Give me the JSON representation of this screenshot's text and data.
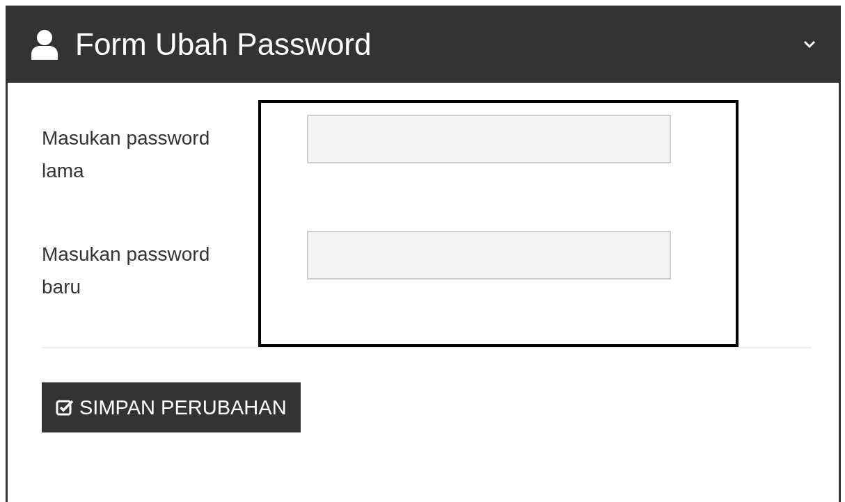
{
  "panel": {
    "title": "Form Ubah Password"
  },
  "fields": [
    {
      "label": "Masukan password lama"
    },
    {
      "label": "Masukan password baru"
    }
  ],
  "buttons": [
    {
      "label": "SIMPAN PERUBAHAN"
    }
  ]
}
